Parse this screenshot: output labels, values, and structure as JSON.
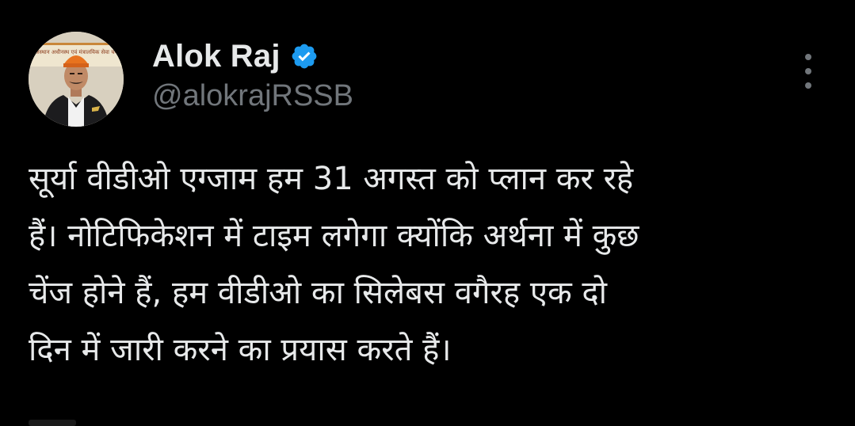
{
  "author": {
    "display_name": "Alok Raj",
    "handle": "@alokrajRSSB",
    "verified_icon": "verified-badge-icon",
    "avatar_banner_text": "राजस्थान अधीनस्थ एवं मंत्रालयिक सेवा चयन बोर्ड"
  },
  "tweet": {
    "lines": [
      "सूर्या वीडीओ एग्जाम हम 31 अगस्त को प्लान कर रहे",
      "हैं। नोटिफिकेशन में टाइम लगेगा क्योंकि अर्थना में कुछ",
      "चेंज होने हैं, हम वीडीओ का सिलेबस वगैरह एक दो",
      "दिन में जारी करने का प्रयास करते हैं।"
    ]
  },
  "menu": {
    "icon": "more-options-icon"
  },
  "colors": {
    "background": "#000000",
    "text_primary": "#e7e9ea",
    "text_secondary": "#71767b",
    "verified_blue": "#1d9bf0"
  }
}
